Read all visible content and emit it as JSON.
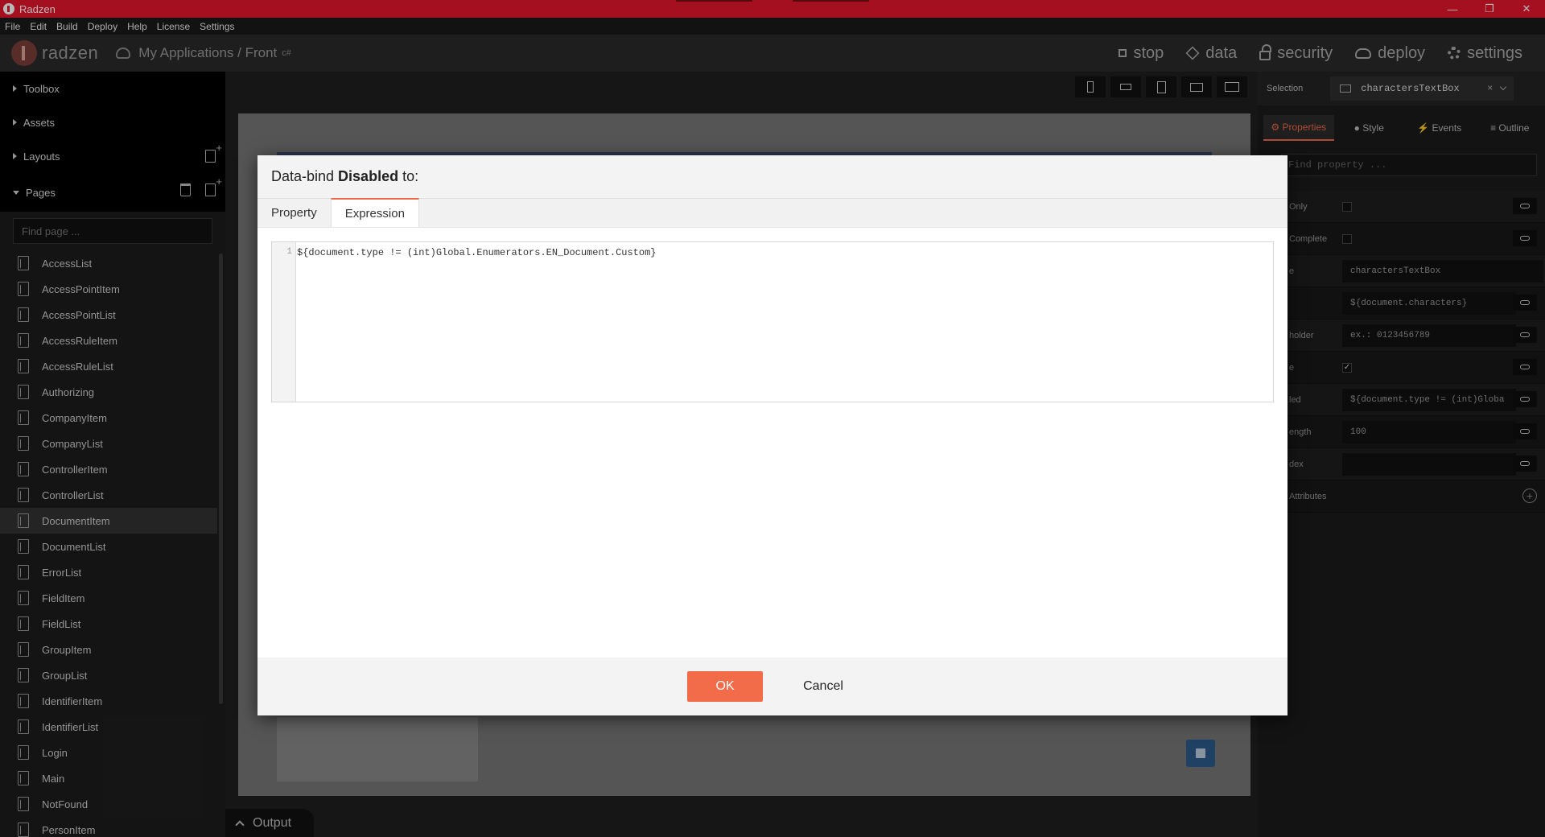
{
  "window": {
    "title": "Radzen"
  },
  "menu": [
    "File",
    "Edit",
    "Build",
    "Deploy",
    "Help",
    "License",
    "Settings"
  ],
  "header": {
    "logo_text": "radzen",
    "breadcrumb": "My Applications / Front",
    "lang_badge": "c#",
    "actions": {
      "stop": "stop",
      "data": "data",
      "security": "security",
      "deploy": "deploy",
      "settings": "settings"
    }
  },
  "sidebar": {
    "sections": {
      "toolbox": "Toolbox",
      "assets": "Assets",
      "layouts": "Layouts",
      "pages": "Pages"
    },
    "find_placeholder": "Find page ...",
    "pages": [
      "AccessList",
      "AccessPointItem",
      "AccessPointList",
      "AccessRuleItem",
      "AccessRuleList",
      "Authorizing",
      "CompanyItem",
      "CompanyList",
      "ControllerItem",
      "ControllerList",
      "DocumentItem",
      "DocumentList",
      "ErrorList",
      "FieldItem",
      "FieldList",
      "GroupItem",
      "GroupList",
      "IdentifierItem",
      "IdentifierList",
      "Login",
      "Main",
      "NotFound",
      "PersonItem"
    ],
    "active_page": "DocumentItem"
  },
  "canvas": {
    "output_label": "Output"
  },
  "right_panel": {
    "selection_label": "Selection",
    "selection_value": "charactersTextBox",
    "tabs": {
      "properties": "Properties",
      "style": "Style",
      "events": "Events",
      "outline": "Outline"
    },
    "find_placeholder": "Find property ...",
    "props": {
      "read_only": {
        "name": "Only"
      },
      "auto_complete": {
        "name": "Complete"
      },
      "name": {
        "name": "e",
        "value": "charactersTextBox"
      },
      "value": {
        "name": "",
        "value": "${document.characters}"
      },
      "placeholder": {
        "name": "holder",
        "value": "ex.: 0123456789"
      },
      "visible": {
        "name": "e"
      },
      "disabled": {
        "name": "led",
        "value": "${document.type != (int)Globa"
      },
      "max_length": {
        "name": "ength",
        "value": "100"
      },
      "tab_index": {
        "name": "dex",
        "value": ""
      },
      "attributes": {
        "name": "Attributes"
      }
    }
  },
  "modal": {
    "title_prefix": "Data-bind",
    "title_bold": "Disabled",
    "title_suffix": "to:",
    "tabs": {
      "property": "Property",
      "expression": "Expression"
    },
    "line_number": "1",
    "expression": "${document.type != (int)Global.Enumerators.EN_Document.Custom}",
    "ok": "OK",
    "cancel": "Cancel"
  }
}
